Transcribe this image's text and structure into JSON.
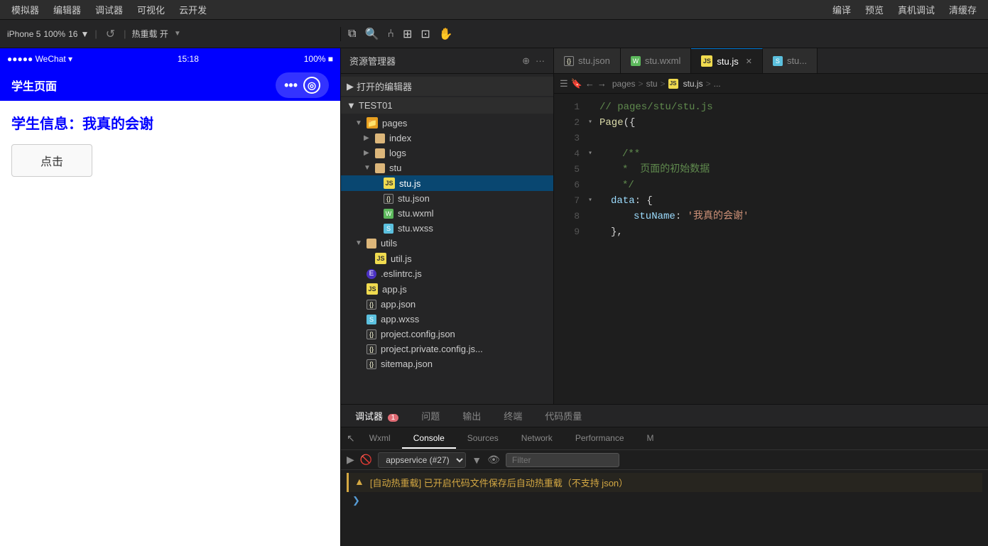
{
  "topMenu": {
    "left": [
      "模拟器",
      "编辑器",
      "调试器",
      "可视化",
      "云开发"
    ],
    "right": [
      "编译",
      "预览",
      "真机调试",
      "清缓存"
    ]
  },
  "toolbar": {
    "deviceLabel": "iPhone 5",
    "zoomLabel": "100%",
    "pageLabel": "16",
    "hotreloadLabel": "热重载 开",
    "ellipsisLabel": "...",
    "icons": [
      "copy-icon",
      "search-icon",
      "git-icon",
      "layout-icon",
      "grid-icon",
      "hand-icon"
    ]
  },
  "filePanel": {
    "title": "资源管理器",
    "moreLabel": "···",
    "sections": [
      {
        "label": "打开的编辑器",
        "expanded": true
      },
      {
        "label": "TEST01",
        "expanded": true
      }
    ],
    "tree": [
      {
        "indent": 1,
        "type": "folder",
        "label": "pages",
        "expanded": true,
        "color": "orange"
      },
      {
        "indent": 2,
        "type": "folder",
        "label": "index",
        "expanded": false,
        "color": "yellow"
      },
      {
        "indent": 2,
        "type": "folder",
        "label": "logs",
        "expanded": false,
        "color": "yellow"
      },
      {
        "indent": 2,
        "type": "folder",
        "label": "stu",
        "expanded": true,
        "color": "yellow"
      },
      {
        "indent": 3,
        "type": "js",
        "label": "stu.js",
        "selected": true
      },
      {
        "indent": 3,
        "type": "json",
        "label": "stu.json"
      },
      {
        "indent": 3,
        "type": "wxml",
        "label": "stu.wxml"
      },
      {
        "indent": 3,
        "type": "wxss",
        "label": "stu.wxss"
      },
      {
        "indent": 1,
        "type": "folder",
        "label": "utils",
        "expanded": true,
        "color": "yellow"
      },
      {
        "indent": 2,
        "type": "js",
        "label": "util.js"
      },
      {
        "indent": 1,
        "type": "eslint",
        "label": ".eslintrc.js"
      },
      {
        "indent": 1,
        "type": "js",
        "label": "app.js"
      },
      {
        "indent": 1,
        "type": "json",
        "label": "app.json"
      },
      {
        "indent": 1,
        "type": "wxss",
        "label": "app.wxss"
      },
      {
        "indent": 1,
        "type": "json",
        "label": "project.config.json"
      },
      {
        "indent": 1,
        "type": "json",
        "label": "project.private.config.js..."
      },
      {
        "indent": 1,
        "type": "json",
        "label": "sitemap.json"
      }
    ]
  },
  "editor": {
    "tabs": [
      {
        "label": "stu.json",
        "type": "json",
        "active": false
      },
      {
        "label": "stu.wxml",
        "type": "wxml",
        "active": false
      },
      {
        "label": "stu.js",
        "type": "js",
        "active": true
      },
      {
        "label": "stu...",
        "type": "wxss",
        "active": false
      }
    ],
    "breadcrumb": [
      "pages",
      ">",
      "stu",
      ">",
      "stu.js",
      ">",
      "..."
    ],
    "navButtons": [
      "list-icon",
      "bookmark-icon",
      "back-icon",
      "forward-icon"
    ],
    "codeLines": [
      {
        "num": "1",
        "arrow": "",
        "code": "comment",
        "text": "// pages/stu/stu.js"
      },
      {
        "num": "2",
        "arrow": "▾",
        "code": "page",
        "text": "Page({"
      },
      {
        "num": "3",
        "arrow": "",
        "code": "",
        "text": ""
      },
      {
        "num": "4",
        "arrow": "▾",
        "code": "comment-block",
        "text": "/**"
      },
      {
        "num": "5",
        "arrow": "",
        "code": "comment-star",
        "text": "* 页面的初始数据"
      },
      {
        "num": "6",
        "arrow": "",
        "code": "comment-end",
        "text": "*/"
      },
      {
        "num": "7",
        "arrow": "▾",
        "code": "data",
        "text": "data: {"
      },
      {
        "num": "8",
        "arrow": "",
        "code": "stuname",
        "text": "stuName: '我真的会谢'"
      },
      {
        "num": "9",
        "arrow": "",
        "code": "close",
        "text": "},"
      }
    ]
  },
  "simulator": {
    "statusBar": {
      "left": "●●●●● WeChat ▾",
      "center": "15:18",
      "right": "100% ■"
    },
    "navBar": {
      "title": "学生页面"
    },
    "content": {
      "studentInfo": "学生信息：我真的会谢",
      "buttonLabel": "点击"
    }
  },
  "debugPanel": {
    "tabs": [
      {
        "label": "调试器",
        "badge": "1",
        "active": true
      },
      {
        "label": "问题",
        "badge": "",
        "active": false
      },
      {
        "label": "输出",
        "badge": "",
        "active": false
      },
      {
        "label": "终端",
        "badge": "",
        "active": false
      },
      {
        "label": "代码质量",
        "badge": "",
        "active": false
      }
    ],
    "chromeTabs": [
      {
        "label": "Wxml",
        "active": false
      },
      {
        "label": "Console",
        "active": true
      },
      {
        "label": "Sources",
        "active": false
      },
      {
        "label": "Network",
        "active": false
      },
      {
        "label": "Performance",
        "active": false
      },
      {
        "label": "M",
        "active": false
      }
    ],
    "serviceSelect": "appservice (#27)",
    "filterPlaceholder": "Filter",
    "warningMessage": "▲ [自动热重载] 已开启代码文件保存后自动热重载（不支持 json）"
  },
  "colors": {
    "accent": "#0078d4",
    "background": "#1e1e1e",
    "sidebarBg": "#252526",
    "activeBg": "#094771",
    "tabActiveBorder": "#0078d4",
    "warningColor": "#d4a843",
    "blue": "#0000ff"
  }
}
